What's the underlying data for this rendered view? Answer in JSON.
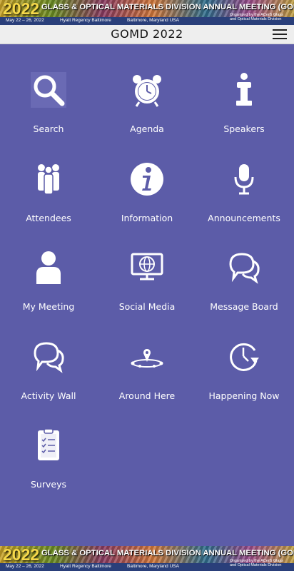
{
  "banner": {
    "year": "2022",
    "headline": "GLASS & OPTICAL MATERIALS DIVISION ANNUAL MEETING (GOMD)",
    "dates": "May 22 – 26, 2022",
    "venue": "Hyatt Regency Baltimore",
    "location": "Baltimore, Maryland USA",
    "organizer": "Organized by the ACerS Glass and Optical Materials Division"
  },
  "header": {
    "title": "GOMD 2022"
  },
  "tiles": [
    {
      "label": "Search",
      "icon": "search-icon"
    },
    {
      "label": "Agenda",
      "icon": "alarm-clock-icon"
    },
    {
      "label": "Speakers",
      "icon": "podium-icon"
    },
    {
      "label": "Attendees",
      "icon": "people-icon"
    },
    {
      "label": "Information",
      "icon": "info-icon"
    },
    {
      "label": "Announcements",
      "icon": "microphone-icon"
    },
    {
      "label": "My Meeting",
      "icon": "person-icon"
    },
    {
      "label": "Social Media",
      "icon": "globe-monitor-icon"
    },
    {
      "label": "Message Board",
      "icon": "chat-bubbles-icon"
    },
    {
      "label": "Activity Wall",
      "icon": "chat-bubbles-icon"
    },
    {
      "label": "Around Here",
      "icon": "map-pin-icon"
    },
    {
      "label": "Happening Now",
      "icon": "clock-arrow-icon"
    },
    {
      "label": "Surveys",
      "icon": "clipboard-icon"
    }
  ],
  "colors": {
    "background": "#5c5ca8",
    "header": "#eeeeee",
    "icon": "#ffffff"
  }
}
